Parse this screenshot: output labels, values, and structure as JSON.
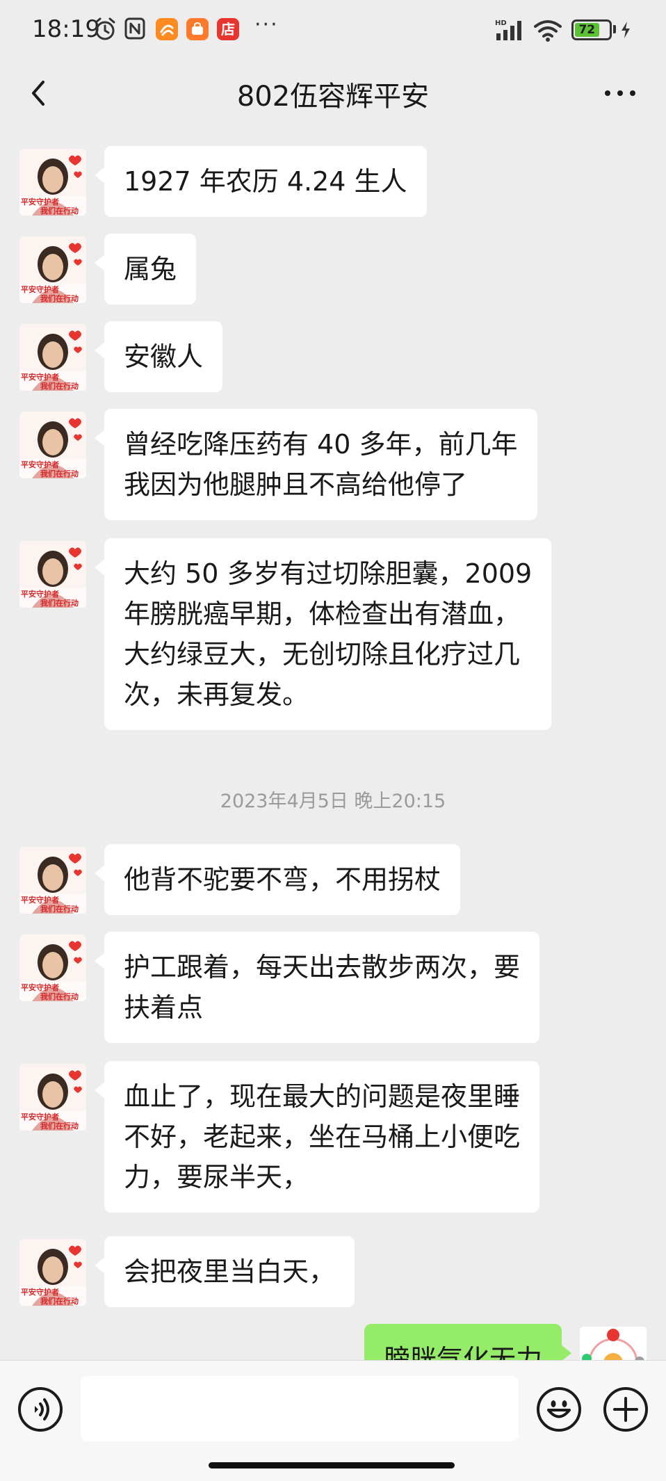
{
  "status_bar": {
    "time": "18:19",
    "battery": "72",
    "more": "···",
    "app_icons": [
      "alarm-icon",
      "nfc-icon",
      "taobao-icon",
      "shop-bag-icon",
      "store-icon"
    ],
    "store_glyph": "店",
    "colors": {
      "taobao": "#ff8a1f",
      "shop": "#ff7a2a",
      "store": "#e8352f",
      "battery": "#5bc236"
    }
  },
  "nav": {
    "title": "802伍容辉平安"
  },
  "avatar_text": {
    "line1": "平安守护者",
    "line2": "我们在行动"
  },
  "messages": [
    {
      "from": "other",
      "lines": [
        "1927 年农历 4.24 生人"
      ]
    },
    {
      "from": "other",
      "lines": [
        "属兔"
      ]
    },
    {
      "from": "other",
      "lines": [
        "安徽人"
      ]
    },
    {
      "from": "other",
      "lines": [
        "曾经吃降压药有 40 多年，前几年",
        "我因为他腿肿且不高给他停了"
      ]
    },
    {
      "from": "other",
      "lines": [
        "大约 50 多岁有过切除胆囊，2009",
        "年膀胱癌早期，体检查出有潜血，",
        "大约绿豆大，无创切除且化疗过几",
        "次，未再复发。"
      ]
    },
    {
      "from": "other",
      "lines": [
        "他背不驼要不弯，不用拐杖"
      ]
    },
    {
      "from": "other",
      "lines": [
        "护工跟着，每天出去散步两次，要",
        "扶着点"
      ]
    },
    {
      "from": "other",
      "lines": [
        "血止了，现在最大的问题是夜里睡",
        "不好，老起来，坐在马桶上小便吃",
        "力，要尿半天，"
      ]
    },
    {
      "from": "other",
      "lines": [
        "会把夜里当白天，"
      ]
    },
    {
      "from": "self",
      "lines": [
        "膀胱气化无力"
      ]
    }
  ],
  "timestamp": "2023年4月5日 晚上20:15",
  "input_bar": {
    "placeholder": "",
    "icons": [
      "voice-icon",
      "emoji-icon",
      "plus-icon"
    ]
  },
  "colors": {
    "background": "#ededed",
    "bubble_other": "#ffffff",
    "bubble_self": "#95ec69"
  }
}
